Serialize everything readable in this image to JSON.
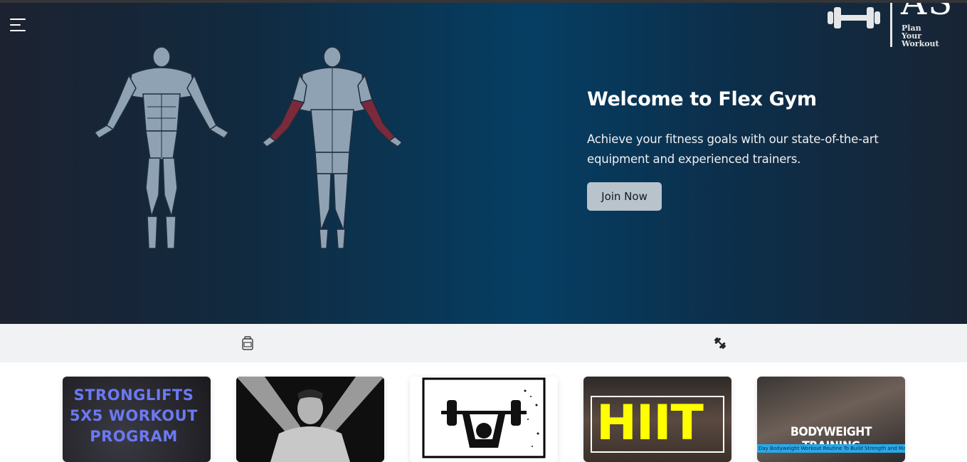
{
  "header": {
    "menu_icon": "hamburger-menu-icon",
    "logo": {
      "icon": "dumbbell-icon",
      "letters": "AS",
      "tagline": [
        "Plan",
        "Your",
        "Workout"
      ]
    }
  },
  "hero": {
    "title": "Welcome to Flex Gym",
    "description": "Achieve your fitness goals with our state-of-the-art equipment and experienced trainers.",
    "cta_label": "Join Now",
    "figures": [
      "muscle-front-figure",
      "muscle-back-figure"
    ],
    "highlight_color": "#7a2a3a",
    "muscle_color": "#8fa2b4"
  },
  "icon_strip": {
    "icons": [
      "protein-jar-icon",
      "dumbbell-diagonal-icon"
    ]
  },
  "cards": [
    {
      "text": "STRONGLIFTS 5X5 WORKOUT PROGRAM",
      "text_color": "#6b79f2"
    },
    {
      "image": "athlete-photo"
    },
    {
      "image": "weightlifter-icon"
    },
    {
      "text": "HIIT",
      "text_color": "#ffff00"
    },
    {
      "text": "BODYWEIGHT TRAINING",
      "subtext": "Day Bodyweight Workout Routine To Build Strength and Mass"
    }
  ]
}
